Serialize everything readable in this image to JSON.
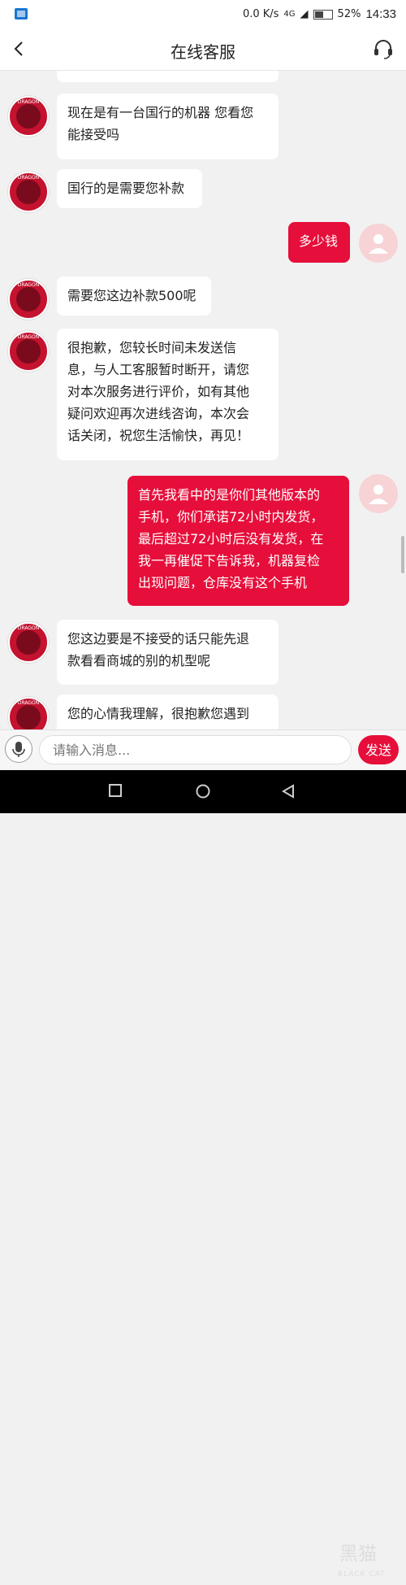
{
  "status_bar": {
    "network": "0.0 K/s",
    "signal": "4G",
    "battery": "52%",
    "time": "14:33"
  },
  "header": {
    "title": "在线客服"
  },
  "messages": [
    {
      "side": "left",
      "text": "现在是有一台国行的机器 您看您\n能接受吗"
    },
    {
      "side": "left",
      "text": "国行的是需要您补款"
    },
    {
      "side": "right",
      "text": "多少钱"
    },
    {
      "side": "left",
      "text": "需要您这边补款500呢"
    },
    {
      "side": "left",
      "text": "很抱歉，您较长时间未发送信\n息，与人工客服暂时断开，请您\n对本次服务进行评价，如有其他\n疑问欢迎再次进线咨询，本次会\n话关闭，祝您生活愉快，再见！"
    },
    {
      "side": "right",
      "text": "首先我看中的是你们其他版本的\n手机，你们承诺72小时内发货，\n最后超过72小时后没有发货，在\n我一再催促下告诉我，机器复检\n出现问题，仓库没有这个手机"
    },
    {
      "side": "left",
      "text": "您这边要是不接受的话只能先退\n款看看商城的别的机型呢"
    },
    {
      "side": "left",
      "text": "您的心情我理解，很抱歉您遇到"
    }
  ],
  "input": {
    "placeholder": "请输入消息...",
    "send_label": "发送"
  },
  "watermark": {
    "cn": "黑猫",
    "en": "BLACK CAT"
  }
}
